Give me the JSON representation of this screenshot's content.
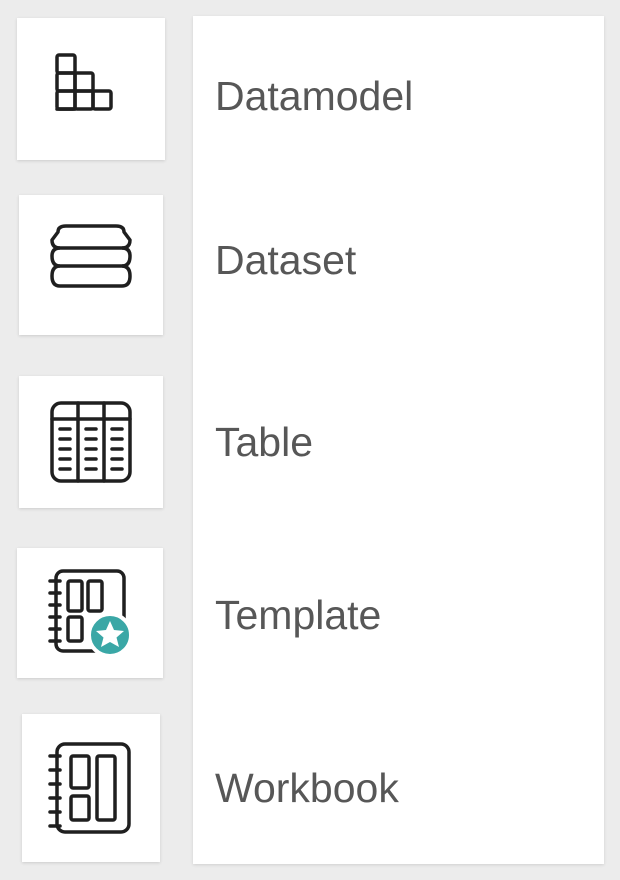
{
  "menu": {
    "items": [
      {
        "label": "Datamodel",
        "icon": "datamodel-icon"
      },
      {
        "label": "Dataset",
        "icon": "dataset-icon"
      },
      {
        "label": "Table",
        "icon": "table-icon"
      },
      {
        "label": "Template",
        "icon": "template-icon"
      },
      {
        "label": "Workbook",
        "icon": "workbook-icon"
      }
    ]
  },
  "colors": {
    "background": "#ececec",
    "panel": "#ffffff",
    "label": "#575757",
    "icon_stroke": "#1f1f1f",
    "template_badge": "#3aa7a6"
  }
}
